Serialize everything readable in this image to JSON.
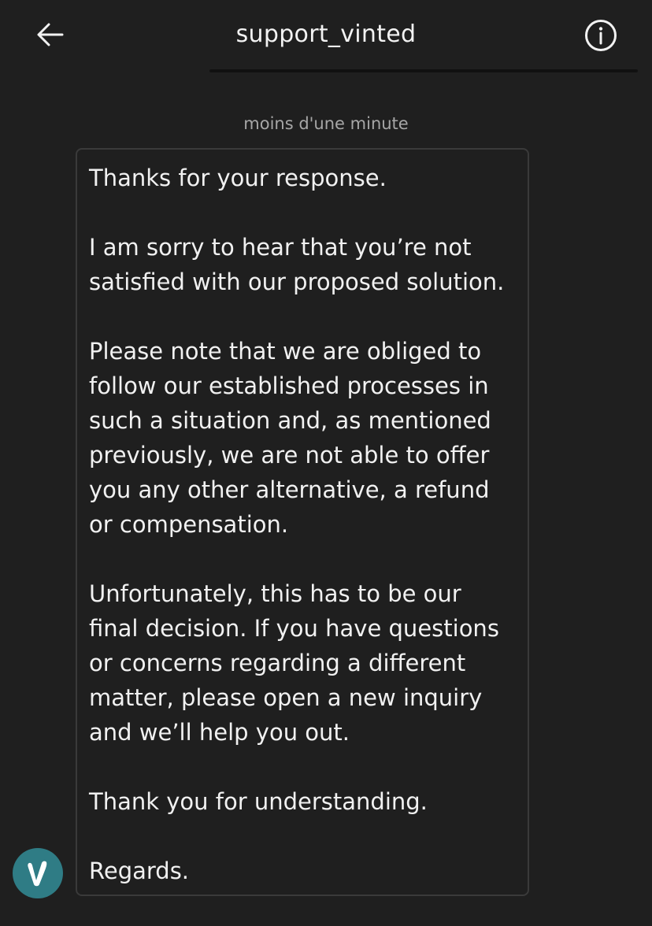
{
  "header": {
    "title": "support_vinted",
    "back_icon": "arrow-left-icon",
    "info_icon": "info-circle-icon"
  },
  "conversation": {
    "timestamp": "moins d'une minute",
    "message": {
      "paragraphs": [
        "Thanks for your response.",
        "I am sorry to hear that you’re not satisfied with our proposed solution.",
        "Please note that we are obliged to follow our established processes in such a situation and, as mentioned previously, we are not able to offer you any other alternative, a refund or compensation.",
        "Unfortunately, this has to be our final decision. If you have questions or concerns regarding a different matter, please open a new inquiry and we’ll help you out.",
        "Thank you for understanding.",
        "Regards."
      ]
    },
    "sender_avatar": {
      "icon": "vinted-logo-icon",
      "letter": "V",
      "color": "#2f7c85"
    }
  },
  "colors": {
    "background": "#1f1f1f",
    "text": "#f0f0f0",
    "muted_text": "#a6a6a6",
    "bubble_border": "#3a3a3a"
  }
}
